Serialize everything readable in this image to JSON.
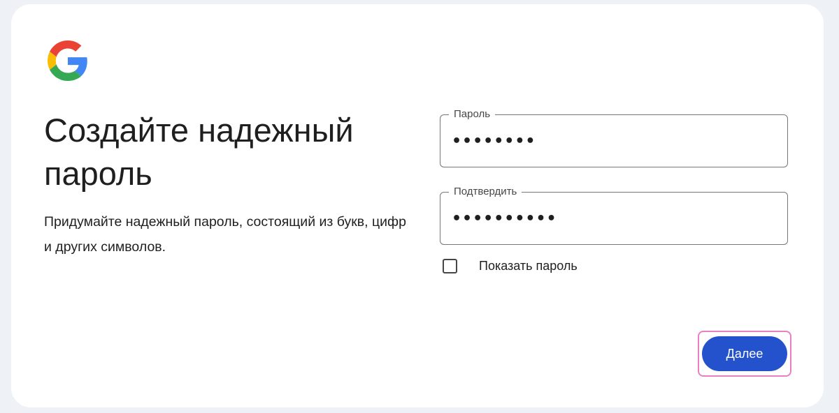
{
  "colors": {
    "primary_button": "#2352cc",
    "highlight_border": "#e97fc0",
    "text": "#1f1f1f",
    "field_border": "#747775",
    "background": "#eef1f6",
    "card": "#ffffff"
  },
  "logo": {
    "icon": "google-logo-icon"
  },
  "heading": {
    "title": "Создайте надежный пароль",
    "subtitle": "Придумайте надежный пароль, состоящий из букв, цифр и других символов."
  },
  "form": {
    "password": {
      "label": "Пароль",
      "value": "••••••••"
    },
    "confirm": {
      "label": "Подтвердить",
      "value": "••••••••••"
    },
    "show_password": {
      "label": "Показать пароль",
      "checked": false
    }
  },
  "actions": {
    "next_label": "Далее"
  }
}
